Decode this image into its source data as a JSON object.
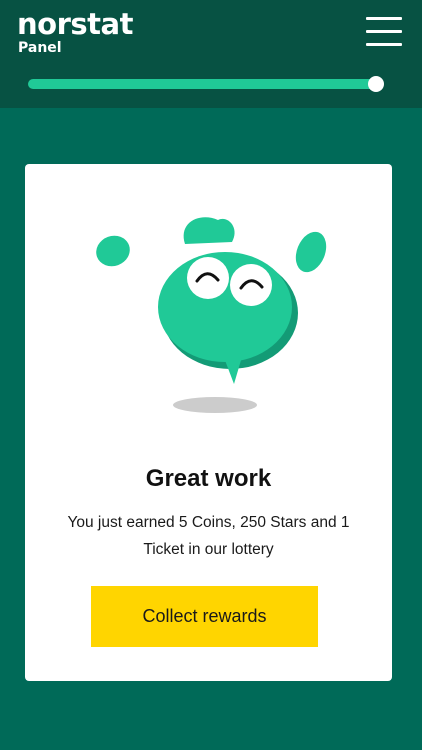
{
  "header": {
    "logo_name": "norstat",
    "logo_sub": "Panel",
    "menu_icon": "hamburger-menu-icon"
  },
  "progress": {
    "fraction": 0.995
  },
  "card": {
    "illustration": "mascot-illustration",
    "title": "Great work",
    "message": "You just earned 5 Coins, 250 Stars and 1 Ticket in our lottery",
    "button_label": "Collect rewards"
  },
  "colors": {
    "header_bg": "#075243",
    "page_bg": "#006a58",
    "accent_green": "#20c997",
    "button_yellow": "#ffd500"
  }
}
